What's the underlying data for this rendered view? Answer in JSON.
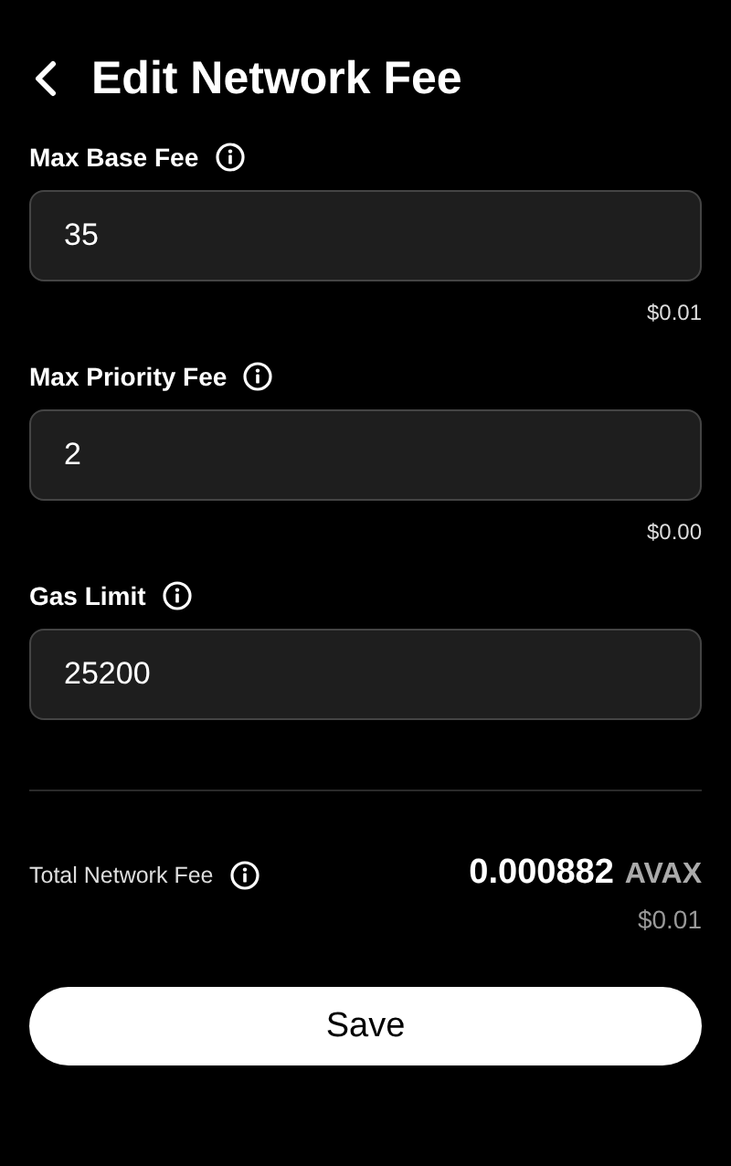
{
  "header": {
    "title": "Edit Network Fee"
  },
  "fields": [
    {
      "label": "Max Base Fee",
      "value": "35",
      "usd": "$0.01"
    },
    {
      "label": "Max Priority Fee",
      "value": "2",
      "usd": "$0.00"
    },
    {
      "label": "Gas Limit",
      "value": "25200"
    }
  ],
  "total": {
    "label": "Total Network Fee",
    "amount": "0.000882",
    "unit": "AVAX",
    "usd": "$0.01"
  },
  "buttons": [
    "Save"
  ]
}
